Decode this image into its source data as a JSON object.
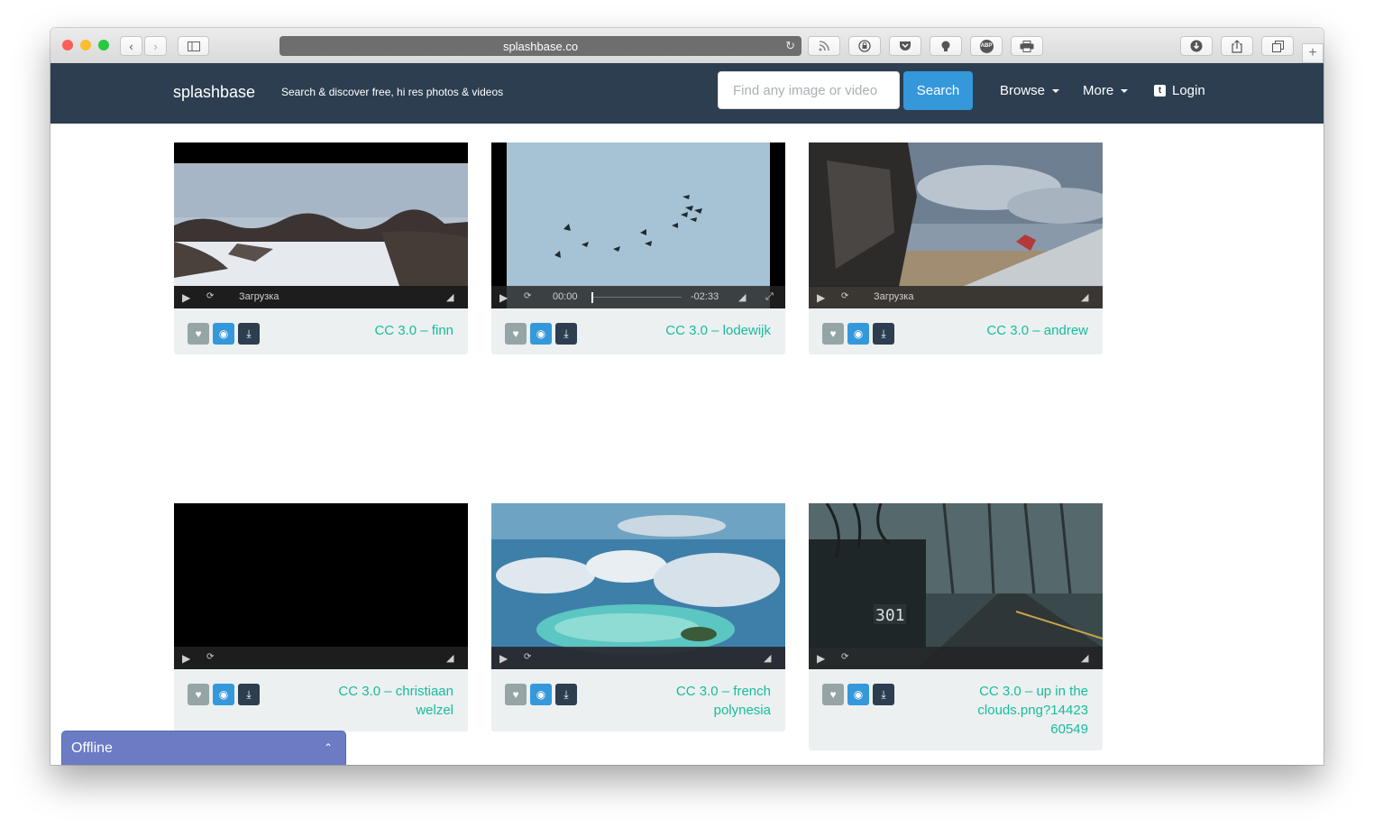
{
  "browser": {
    "url": "splashbase.co",
    "toolbar_icons": [
      "back-icon",
      "forward-icon",
      "sidebar-icon",
      "rss-icon",
      "password-icon",
      "pocket-icon",
      "bulb-icon",
      "abp-icon",
      "print-icon",
      "download-icon",
      "share-icon",
      "tabs-icon",
      "new-tab-icon"
    ],
    "abp_label": "ABP"
  },
  "nav": {
    "brand": "splashbase",
    "tagline": "Search & discover free, hi res photos & videos",
    "search_placeholder": "Find any image or video",
    "search_button": "Search",
    "browse": "Browse",
    "more": "More",
    "login": "Login"
  },
  "cards": [
    {
      "license": "CC 3.0",
      "sep": " – ",
      "author": "finn",
      "status": "Загрузка",
      "colors": [
        "#a9b7c6",
        "#cfd6de",
        "#3b3330",
        "#e8ecef"
      ]
    },
    {
      "license": "CC 3.0",
      "sep": " – ",
      "author": "lodewijk",
      "time_current": "00:00",
      "time_remaining": "-02:33",
      "colors": [
        "#9fc0d2",
        "#b9d2df"
      ]
    },
    {
      "license": "CC 3.0",
      "sep": " – ",
      "author": "andrew",
      "status": "Загрузка",
      "colors": [
        "#6d7f93",
        "#b8c4cf",
        "#9c8b73"
      ]
    },
    {
      "license": "CC 3.0",
      "sep": " – ",
      "author": "christiaan welzel",
      "colors": [
        "#000000"
      ]
    },
    {
      "license": "CC 3.0",
      "sep": " – ",
      "author": "french polynesia",
      "colors": [
        "#3d7fa8",
        "#d8e4ec",
        "#58c0c0"
      ]
    },
    {
      "license": "CC 3.0",
      "sep": " – ",
      "author": "up in the clouds.png?1442360549",
      "colors": [
        "#2f3c3e",
        "#56686b",
        "#1f2627"
      ],
      "mailbox_number": "301"
    }
  ],
  "offline_widget": {
    "label": "Offline"
  }
}
